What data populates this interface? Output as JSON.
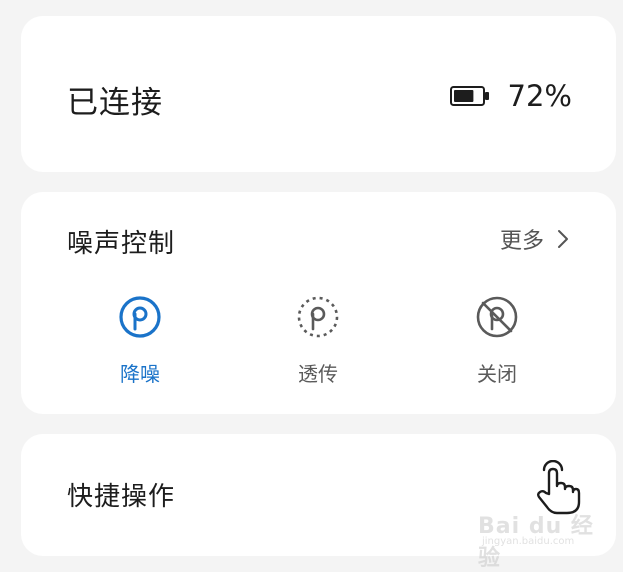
{
  "status_card": {
    "connection_status": "已连接",
    "battery_percent": "72%",
    "battery_level": 0.72
  },
  "noise_control": {
    "title": "噪声控制",
    "more_label": "更多",
    "modes": [
      {
        "label": "降噪",
        "icon": "anc-icon",
        "active": true
      },
      {
        "label": "透传",
        "icon": "transparency-icon",
        "active": false
      },
      {
        "label": "关闭",
        "icon": "noise-off-icon",
        "active": false
      }
    ]
  },
  "quick_actions": {
    "title": "快捷操作",
    "icon": "tap-gesture-icon"
  },
  "watermark": {
    "logo": "Bai du 经验",
    "url": "jingyan.baidu.com"
  },
  "colors": {
    "accent": "#1a73c9",
    "text_primary": "#1d1d1d",
    "text_secondary": "#5a5a5a",
    "background": "#f4f4f4",
    "card": "#ffffff"
  }
}
